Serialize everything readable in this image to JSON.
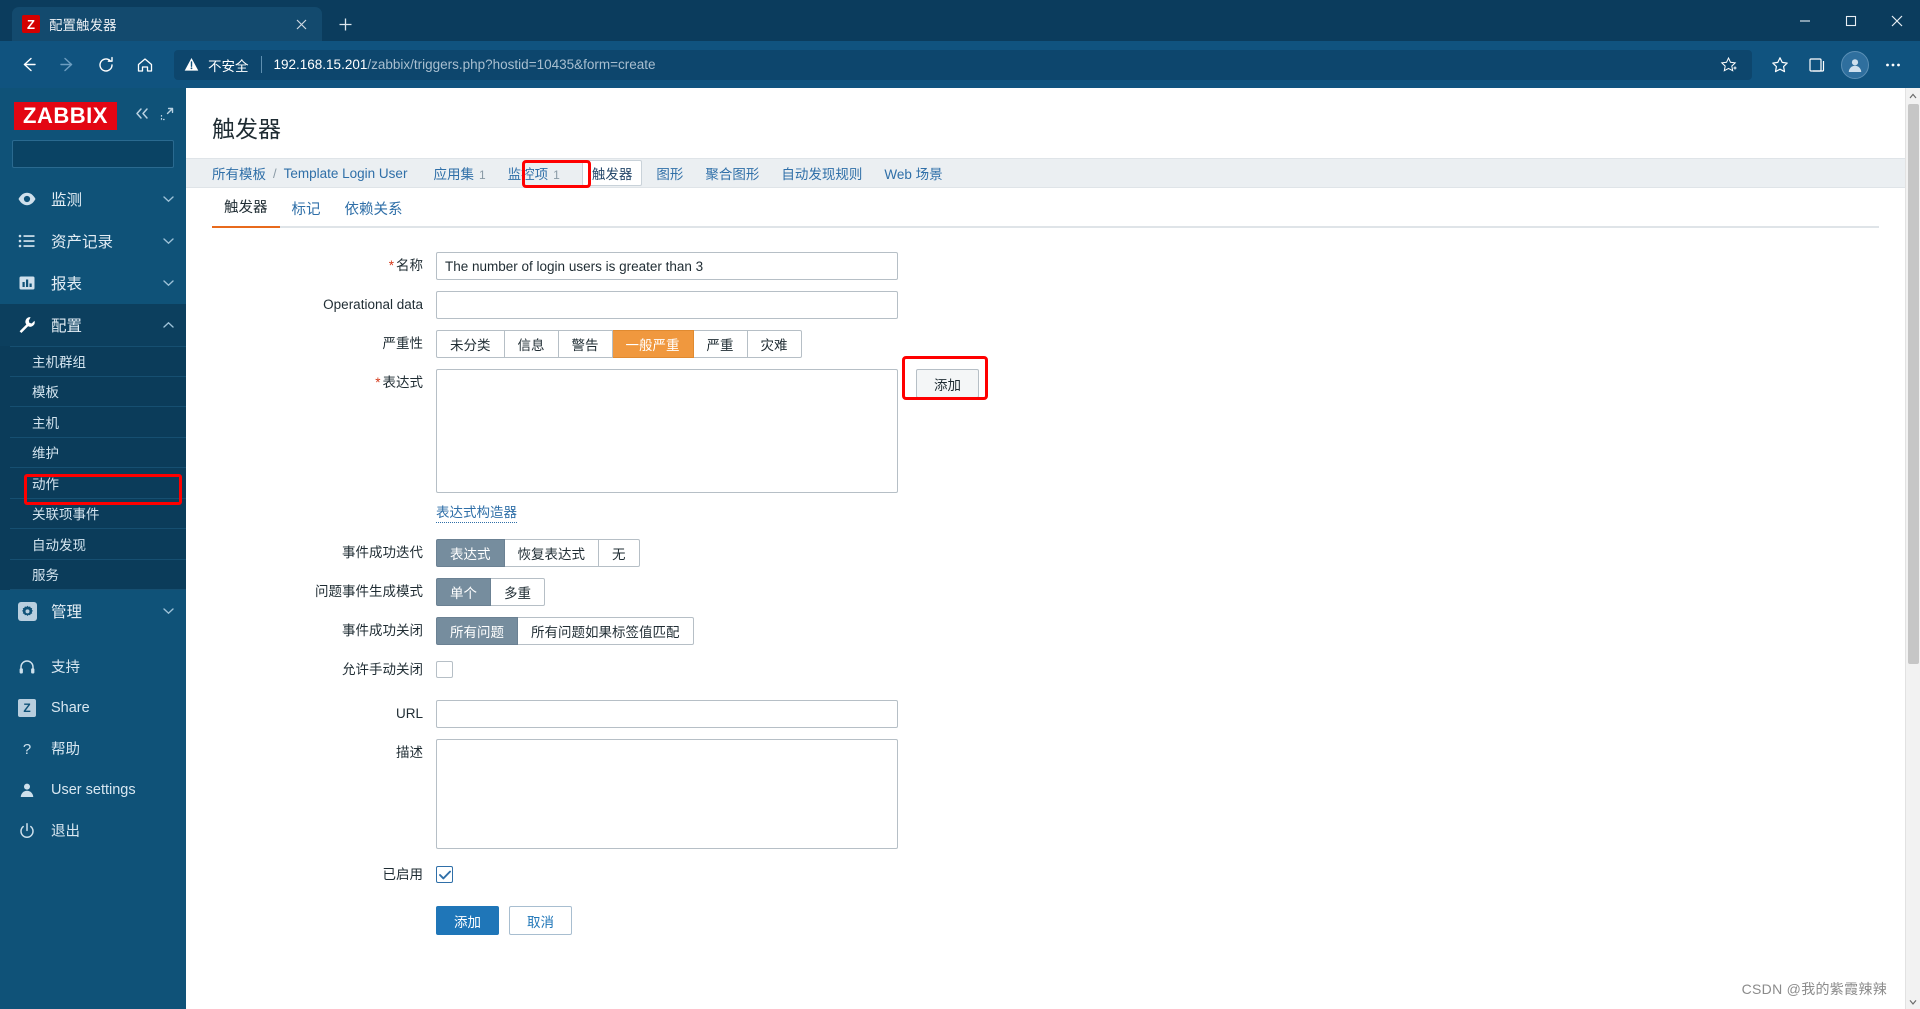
{
  "browser": {
    "tab": {
      "favicon_letter": "Z",
      "title": "配置触发器",
      "close_icon": "close-icon",
      "new_tab_icon": "plus-icon"
    },
    "window": {
      "minimize": "minimize-icon",
      "maximize": "maximize-icon",
      "close": "close-icon"
    },
    "nav": {
      "back": "back-arrow-icon",
      "forward": "forward-arrow-icon",
      "reload": "reload-icon",
      "home": "home-icon"
    },
    "omnibox": {
      "warning_icon": "warning-triangle-icon",
      "security_label": "不安全",
      "url_host": "192.168.15.201",
      "url_path": "/zabbix/triggers.php?hostid=10435&form=create",
      "favorite_add_icon": "add-favorite-icon"
    },
    "toolbar": {
      "favorites_icon": "favorites-star-icon",
      "collections_icon": "collections-icon",
      "profile_icon": "profile-avatar-icon",
      "more_icon": "more-options-icon"
    }
  },
  "sidebar": {
    "logo": "ZABBIX",
    "collapse_icon": "collapse-sidebar-icon",
    "hide_icon": "hide-sidebar-icon",
    "search_placeholder": "",
    "search_icon": "search-icon",
    "items": [
      {
        "label": "监测",
        "icon": "eye-icon",
        "chevron": "chevron-down-icon",
        "active": false
      },
      {
        "label": "资产记录",
        "icon": "list-icon",
        "chevron": "chevron-down-icon",
        "active": false
      },
      {
        "label": "报表",
        "icon": "chart-bar-icon",
        "chevron": "chevron-down-icon",
        "active": false
      },
      {
        "label": "配置",
        "icon": "wrench-icon",
        "chevron": "chevron-up-icon",
        "active": true
      }
    ],
    "submenu": [
      {
        "label": "主机群组"
      },
      {
        "label": "模板"
      },
      {
        "label": "主机",
        "highlighted": true
      },
      {
        "label": "维护"
      },
      {
        "label": "动作"
      },
      {
        "label": "关联项事件"
      },
      {
        "label": "自动发现"
      },
      {
        "label": "服务"
      }
    ],
    "admin": {
      "label": "管理",
      "icon": "gear-icon",
      "chevron": "chevron-down-icon"
    },
    "bottom": [
      {
        "label": "支持",
        "icon": "headset-icon"
      },
      {
        "label": "Share",
        "icon": "zabbix-share-icon"
      },
      {
        "label": "帮助",
        "icon": "question-mark-icon"
      },
      {
        "label": "User settings",
        "icon": "person-icon"
      },
      {
        "label": "退出",
        "icon": "power-icon"
      }
    ]
  },
  "page": {
    "title": "触发器",
    "breadcrumb": {
      "root": "所有模板",
      "separator": "/",
      "template": "Template Login User",
      "tabs": [
        {
          "label": "应用集",
          "count": "1",
          "selected": false
        },
        {
          "label": "监控项",
          "count": "1",
          "selected": false
        },
        {
          "label": "触发器",
          "count": "",
          "selected": true
        },
        {
          "label": "图形",
          "count": "",
          "selected": false
        },
        {
          "label": "聚合图形",
          "count": "",
          "selected": false
        },
        {
          "label": "自动发现规则",
          "count": "",
          "selected": false
        },
        {
          "label": "Web 场景",
          "count": "",
          "selected": false
        }
      ]
    },
    "form_tabs": [
      {
        "label": "触发器",
        "active": true
      },
      {
        "label": "标记",
        "active": false
      },
      {
        "label": "依赖关系",
        "active": false
      }
    ]
  },
  "form": {
    "name": {
      "label": "名称",
      "required": true,
      "value": "The number of login users is greater than 3",
      "placeholder": ""
    },
    "operational_data": {
      "label": "Operational data",
      "value": "",
      "placeholder": ""
    },
    "severity": {
      "label": "严重性",
      "options": [
        "未分类",
        "信息",
        "警告",
        "一般严重",
        "严重",
        "灾难"
      ],
      "selected": "一般严重"
    },
    "expression": {
      "label": "表达式",
      "required": true,
      "value": "",
      "placeholder": "",
      "add_button": "添加",
      "constructor_link": "表达式构造器"
    },
    "event_generation": {
      "label": "事件成功迭代",
      "options": [
        "表达式",
        "恢复表达式",
        "无"
      ],
      "selected": "表达式"
    },
    "problem_event_mode": {
      "label": "问题事件生成模式",
      "options": [
        "单个",
        "多重"
      ],
      "selected": "单个"
    },
    "event_close": {
      "label": "事件成功关闭",
      "options": [
        "所有问题",
        "所有问题如果标签值匹配"
      ],
      "selected": "所有问题"
    },
    "manual_close": {
      "label": "允许手动关闭",
      "checked": false
    },
    "url": {
      "label": "URL",
      "value": "",
      "placeholder": ""
    },
    "description": {
      "label": "描述",
      "value": "",
      "placeholder": ""
    },
    "enabled": {
      "label": "已启用",
      "checked": true
    },
    "actions": {
      "submit": "添加",
      "cancel": "取消"
    }
  },
  "watermark": "CSDN @我的紫霞辣辣"
}
